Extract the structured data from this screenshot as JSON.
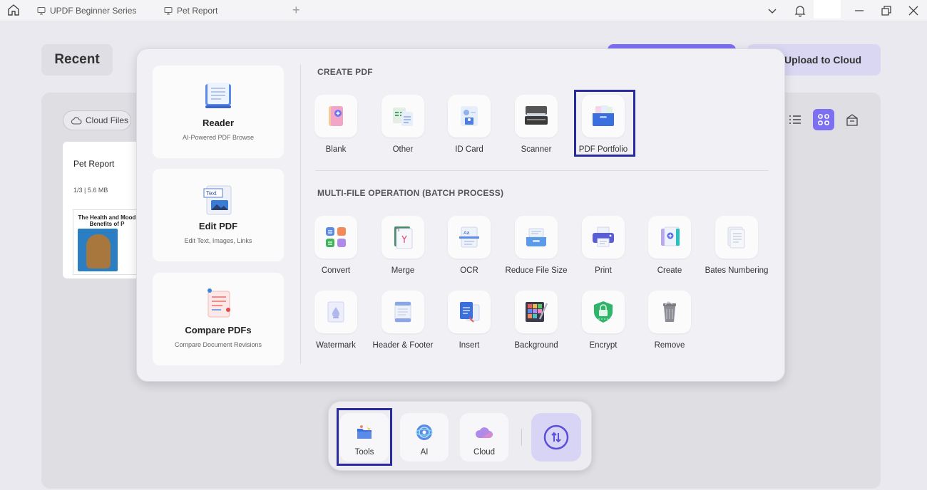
{
  "titlebar": {
    "tabs": [
      {
        "label": "UPDF Beginner Series"
      },
      {
        "label": "Pet Report"
      }
    ],
    "add_tab": "+"
  },
  "page": {
    "recent_label": "Recent",
    "upload_label": "Upload to Cloud",
    "cloud_files_label": "Cloud Files",
    "file_card": {
      "name": "Pet Report",
      "meta": "1/3 | 5.6 MB",
      "thumb_title": "The Health and Mood\nBenefits of P"
    }
  },
  "popup": {
    "left_cards": [
      {
        "title": "Reader",
        "subtitle": "AI-Powered PDF Browse"
      },
      {
        "title": "Edit PDF",
        "subtitle": "Edit Text, Images, Links"
      },
      {
        "title": "Compare PDFs",
        "subtitle": "Compare Document Revisions"
      }
    ],
    "create_section": {
      "title": "CREATE PDF",
      "tools": [
        {
          "label": "Blank",
          "icon": "blank-page-icon"
        },
        {
          "label": "Other",
          "icon": "other-format-icon"
        },
        {
          "label": "ID Card",
          "icon": "id-card-icon"
        },
        {
          "label": "Scanner",
          "icon": "scanner-icon"
        },
        {
          "label": "PDF Portfolio",
          "icon": "portfolio-icon"
        }
      ]
    },
    "batch_section": {
      "title": "MULTI-FILE OPERATION (BATCH PROCESS)",
      "tools_row1": [
        {
          "label": "Convert",
          "icon": "convert-icon"
        },
        {
          "label": "Merge",
          "icon": "merge-icon"
        },
        {
          "label": "OCR",
          "icon": "ocr-icon"
        },
        {
          "label": "Reduce File Size",
          "icon": "reduce-size-icon"
        },
        {
          "label": "Print",
          "icon": "print-icon"
        },
        {
          "label": "Create",
          "icon": "create-icon"
        },
        {
          "label": "Bates Numbering",
          "icon": "bates-icon"
        }
      ],
      "tools_row2": [
        {
          "label": "Watermark",
          "icon": "watermark-icon"
        },
        {
          "label": "Header & Footer",
          "icon": "header-footer-icon"
        },
        {
          "label": "Insert",
          "icon": "insert-icon"
        },
        {
          "label": "Background",
          "icon": "background-icon"
        },
        {
          "label": "Encrypt",
          "icon": "encrypt-icon"
        },
        {
          "label": "Remove",
          "icon": "remove-icon"
        }
      ]
    }
  },
  "dock": {
    "items": [
      {
        "label": "Tools",
        "icon": "tools-icon"
      },
      {
        "label": "AI",
        "icon": "ai-icon"
      },
      {
        "label": "Cloud",
        "icon": "cloud-icon"
      }
    ]
  },
  "colors": {
    "accent": "#7c6ff0",
    "highlight": "#2a2aa0",
    "background": "#e9e9ef",
    "popup": "#f1f1f5"
  }
}
